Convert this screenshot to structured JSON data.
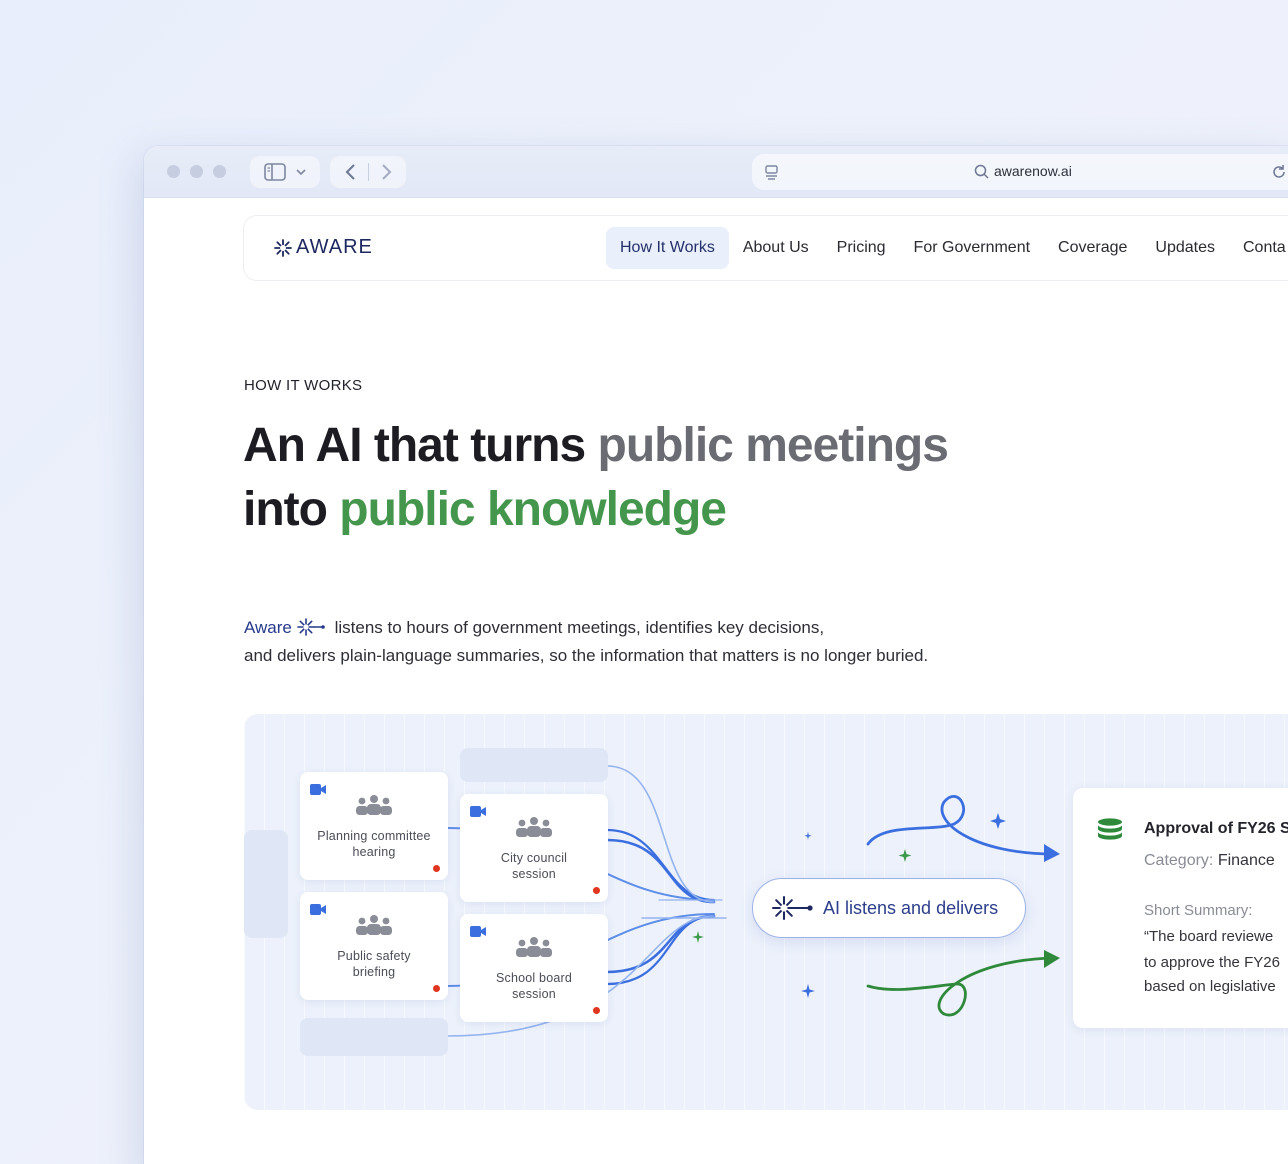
{
  "browser": {
    "url": "awarenow.ai"
  },
  "nav": {
    "logo_text": "AWARE",
    "links": [
      {
        "label": "How It Works",
        "active": true
      },
      {
        "label": "About Us"
      },
      {
        "label": "Pricing"
      },
      {
        "label": "For Government"
      },
      {
        "label": "Coverage"
      },
      {
        "label": "Updates"
      },
      {
        "label": "Conta"
      }
    ]
  },
  "hero": {
    "eyebrow": "HOW IT WORKS",
    "headline_part1": "An AI that turns ",
    "headline_part2": "public meetings",
    "headline_part3": "into ",
    "headline_part4": "public knowledge",
    "desc_brand": "Aware",
    "desc_line1": "listens to hours of government meetings, identifies key decisions,",
    "desc_line2": "and delivers plain-language summaries, so the information that matters is no longer buried."
  },
  "diagram": {
    "meetings": [
      {
        "line1": "Planning committee",
        "line2": "hearing"
      },
      {
        "line1": "City council",
        "line2": "session"
      },
      {
        "line1": "Public safety",
        "line2": "briefing"
      },
      {
        "line1": "School board",
        "line2": "session"
      }
    ],
    "center_label": "AI listens and delivers",
    "result": {
      "title": "Approval of FY26 S",
      "category_key": "Category:",
      "category_value": "Finance",
      "summary_label": "Short Summary:",
      "summary_lines": [
        "“The board reviewe",
        "to approve the FY26",
        "based on legislative"
      ]
    }
  },
  "colors": {
    "brand_navy": "#1d2860",
    "green": "#44964c",
    "blue_flow": "#3b6fe0",
    "record_red": "#e0361f"
  },
  "icons": [
    "sidebar-icon",
    "chevron-down-icon",
    "back-arrow-icon",
    "forward-arrow-icon",
    "reader-icon",
    "search-icon",
    "reload-icon",
    "aware-logo-icon",
    "video-camera-icon",
    "people-group-icon",
    "database-stack-icon",
    "sparkle-icon"
  ]
}
